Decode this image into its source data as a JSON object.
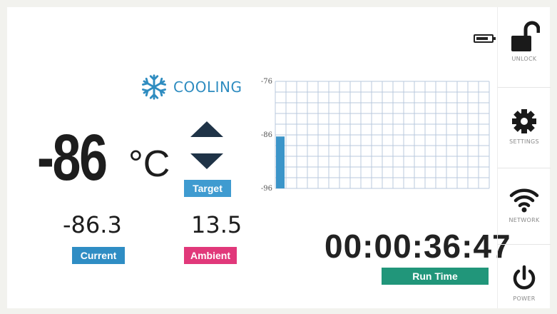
{
  "status": {
    "icon": "snowflake-icon",
    "label": "COOLING"
  },
  "temperature": {
    "value": "-86",
    "unit": "°C"
  },
  "target": {
    "label": "Target"
  },
  "current": {
    "value": "-86.3",
    "label": "Current"
  },
  "ambient": {
    "value": "13.5",
    "label": "Ambient"
  },
  "run_time": {
    "value": "00:00:36:47",
    "label": "Run Time"
  },
  "battery": {
    "icon": "battery-icon"
  },
  "sidebar": {
    "items": [
      {
        "label": "UNLOCK",
        "icon": "unlock-icon"
      },
      {
        "label": "SETTINGS",
        "icon": "gear-icon"
      },
      {
        "label": "NETWORK",
        "icon": "wifi-icon"
      },
      {
        "label": "POWER",
        "icon": "power-icon"
      }
    ]
  },
  "colors": {
    "accent_blue": "#2f8dc4",
    "ambient_pink": "#e1387a",
    "runtime_green": "#21967a",
    "arrow_navy": "#1f3347",
    "grid_blue": "#b8c9dd"
  },
  "chart_data": {
    "type": "bar",
    "ylim": [
      -96,
      -76
    ],
    "yticks": [
      "-76",
      "-86",
      "-96"
    ],
    "values": [
      -86.3
    ],
    "grid": true,
    "color": "#3b95c9"
  }
}
